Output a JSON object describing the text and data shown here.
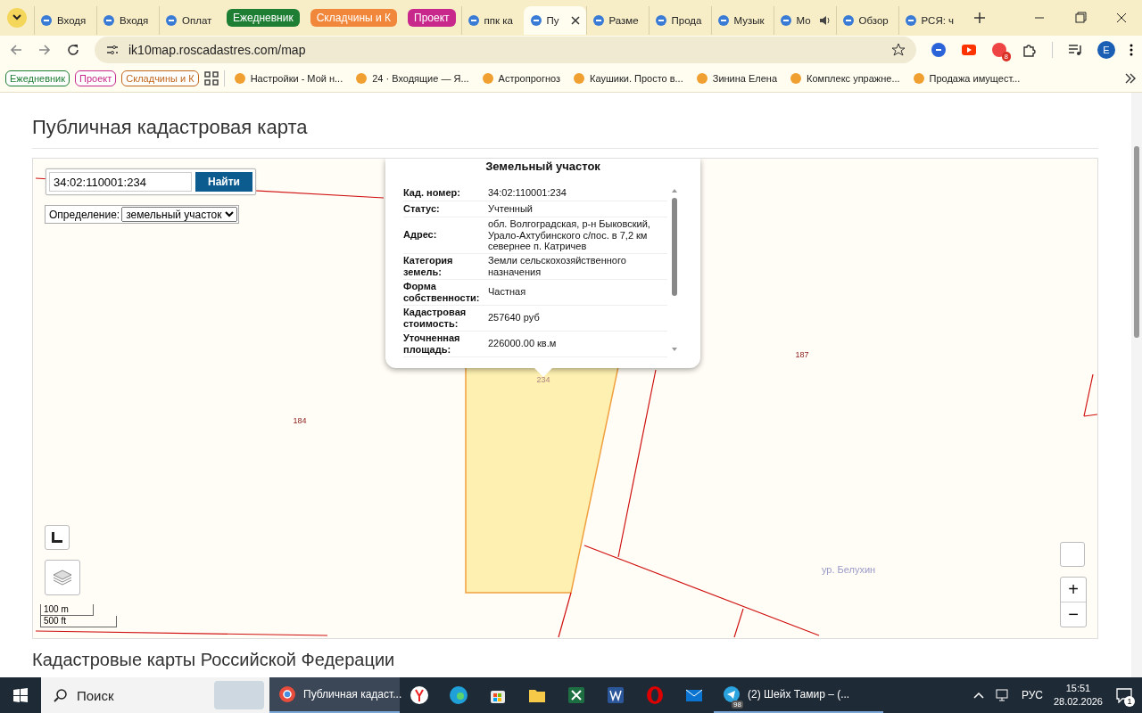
{
  "browser": {
    "tabs": [
      {
        "kind": "tab",
        "label": "Входя",
        "selected": false,
        "audio": false
      },
      {
        "kind": "tab",
        "label": "Входя",
        "selected": false,
        "audio": false
      },
      {
        "kind": "tab",
        "label": "Оплат",
        "selected": false,
        "audio": false
      },
      {
        "kind": "group",
        "label": "Ежедневник",
        "color": "#1e7e34"
      },
      {
        "kind": "group",
        "label": "Складчины и К",
        "color": "#f0873a"
      },
      {
        "kind": "group",
        "label": "Проект",
        "color": "#c8288c"
      },
      {
        "kind": "tab",
        "label": "ппк ка",
        "selected": false,
        "audio": false
      },
      {
        "kind": "tab",
        "label": "Пу",
        "selected": true,
        "audio": false
      },
      {
        "kind": "tab",
        "label": "Разме",
        "selected": false,
        "audio": false
      },
      {
        "kind": "tab",
        "label": "Прода",
        "selected": false,
        "audio": false
      },
      {
        "kind": "tab",
        "label": "Музык",
        "selected": false,
        "audio": false
      },
      {
        "kind": "tab",
        "label": "Мо",
        "selected": false,
        "audio": true
      },
      {
        "kind": "tab",
        "label": "Обзор",
        "selected": false,
        "audio": false
      },
      {
        "kind": "tab",
        "label": "РСЯ: ч",
        "selected": false,
        "audio": false
      }
    ],
    "address": "ik10map.roscadastres.com/map",
    "extension_badge": "8",
    "profile": "E",
    "bookmarks": [
      {
        "kind": "group",
        "label": "Ежедневник",
        "color": "#1e7e34"
      },
      {
        "kind": "group",
        "label": "Проект",
        "color": "#c8288c"
      },
      {
        "kind": "group",
        "label": "Складчины и К",
        "color": "#c0661c"
      },
      {
        "kind": "link",
        "label": "Настройки - Мой н..."
      },
      {
        "kind": "link",
        "label": "24 · Входящие — Я..."
      },
      {
        "kind": "link",
        "label": "Астропрогноз"
      },
      {
        "kind": "link",
        "label": "Каушики. Просто в..."
      },
      {
        "kind": "link",
        "label": "Зинина Елена"
      },
      {
        "kind": "link",
        "label": "Комплекс упражне..."
      },
      {
        "kind": "link",
        "label": "Продажа имущест..."
      }
    ]
  },
  "page": {
    "title": "Публичная кадастровая карта",
    "search": {
      "value": "34:02:110001:234",
      "button": "Найти"
    },
    "definition": {
      "label": "Определение:",
      "value": "земельный участок"
    },
    "popup": {
      "title": "Земельный участок",
      "rows": [
        {
          "label": "Кад. номер:",
          "value": "34:02:110001:234"
        },
        {
          "label": "Статус:",
          "value": "Учтенный"
        },
        {
          "label": "Адрес:",
          "value": "обл. Волгоградская, р-н Быковский, Урало-Ахтубинского с/пос. в 7,2 км севернее п. Катричев"
        },
        {
          "label": "Категория земель:",
          "value": "Земли сельскохозяйственного назначения"
        },
        {
          "label": "Форма собственности:",
          "value": "Частная"
        },
        {
          "label": "Кадастровая стоимость:",
          "value": "257640 руб"
        },
        {
          "label": "Уточненная площадь:",
          "value": "226000.00 кв.м"
        }
      ]
    },
    "parcel_label": "234",
    "parcel_numbers": [
      "187",
      "184"
    ],
    "place_label": "ур. Белухин",
    "scale": [
      "100 m",
      "500 ft"
    ],
    "zoom": [
      "+",
      "−"
    ],
    "section_title": "Кадастровые карты Российской Федерации"
  },
  "taskbar": {
    "search": {
      "placeholder": "Поиск"
    },
    "apps": [
      {
        "label": "Публичная кадаст...",
        "selected": true
      },
      {
        "label": "(2) Шейх Тамир – (...",
        "selected": false,
        "badge": "98"
      }
    ],
    "language": "РУС",
    "time": "15:51",
    "date": "28.02.2026",
    "notifications": "1"
  }
}
